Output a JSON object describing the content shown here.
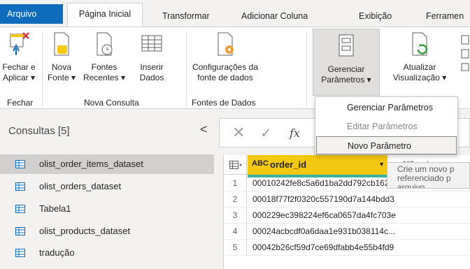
{
  "tabs": {
    "file": "Arquivo",
    "home": "Página Inicial",
    "transform": "Transformar",
    "add_column": "Adicionar Coluna",
    "view": "Exibição",
    "tools": "Ferramen"
  },
  "ribbon": {
    "close_apply": "Fechar e\nAplicar ▾",
    "new_source": "Nova\nFonte ▾",
    "recent_sources": "Fontes\nRecentes ▾",
    "enter_data": "Inserir\nDados",
    "data_source_settings": "Configurações da\nfonte de dados",
    "manage_params": "Gerenciar\nParâmetros ▾",
    "refresh_preview": "Atualizar\nVisualização ▾",
    "groups": {
      "close": "Fechar",
      "new_query": "Nova Consulta",
      "data_sources": "Fontes de Dados"
    }
  },
  "dropdown": {
    "items": [
      "Gerenciar Parâmetros",
      "Editar Parâmetros",
      "Novo Parâmetro"
    ]
  },
  "tooltip": "Crie um novo p\nreferenciado p\narquivo.",
  "sidebar": {
    "header": "Consultas [5]",
    "collapse": "<",
    "items": [
      "olist_order_items_dataset",
      "olist_orders_dataset",
      "Tabela1",
      "olist_products_dataset",
      "tradução"
    ]
  },
  "formula": {
    "fx": "fx"
  },
  "grid": {
    "column_type": "ABC",
    "column_name": "order_id",
    "next_column": "1²3 ord",
    "rows": [
      {
        "n": "1",
        "v": "00010242fe8c5a6d1ba2dd792cb162..."
      },
      {
        "n": "2",
        "v": "00018f77f2f0320c557190d7a144bdd3"
      },
      {
        "n": "3",
        "v": "000229ec398224ef6ca0657da4fc703e"
      },
      {
        "n": "4",
        "v": "00024acbcdf0a6daa1e931b038114c..."
      },
      {
        "n": "5",
        "v": "00042b26cf59d7ce69dfabb4e55b4fd9"
      }
    ]
  },
  "colors": {
    "accent": "#0f6cbd",
    "column_header": "#f2c811",
    "quality_bar": "#3ab0a1"
  }
}
